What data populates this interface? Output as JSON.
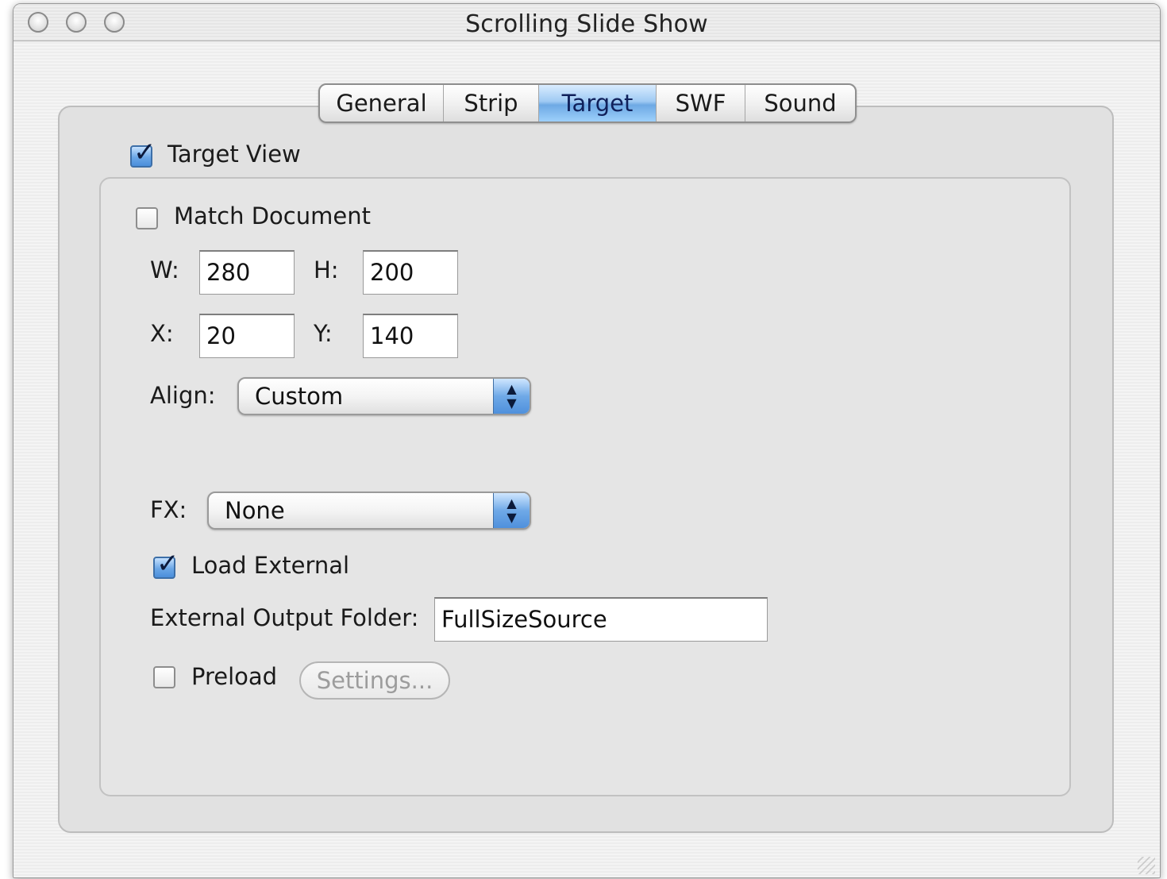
{
  "window": {
    "title": "Scrolling Slide Show"
  },
  "tabs": [
    {
      "label": "General",
      "active": false
    },
    {
      "label": "Strip",
      "active": false
    },
    {
      "label": "Target",
      "active": true
    },
    {
      "label": "SWF",
      "active": false
    },
    {
      "label": "Sound",
      "active": false
    }
  ],
  "target_view": {
    "label": "Target View",
    "checked": true
  },
  "match_document": {
    "label": "Match Document",
    "checked": false
  },
  "fields": {
    "w": {
      "label": "W:",
      "value": "280"
    },
    "h": {
      "label": "H:",
      "value": "200"
    },
    "x": {
      "label": "X:",
      "value": "20"
    },
    "y": {
      "label": "Y:",
      "value": "140"
    }
  },
  "align": {
    "label": "Align:",
    "value": "Custom"
  },
  "fx": {
    "label": "FX:",
    "value": "None"
  },
  "load_external": {
    "label": "Load External",
    "checked": true
  },
  "external_output_folder": {
    "label": "External Output Folder:",
    "value": "FullSizeSource"
  },
  "preload": {
    "label": "Preload",
    "checked": false
  },
  "settings_button": {
    "label": "Settings..."
  }
}
